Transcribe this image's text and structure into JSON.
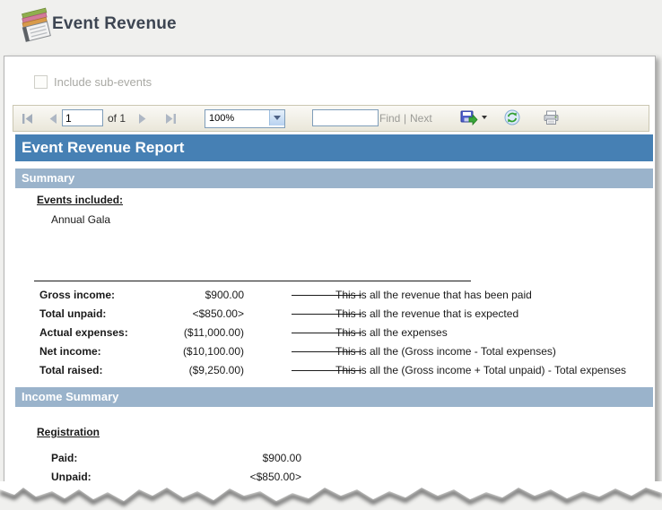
{
  "header": {
    "title": "Event Revenue"
  },
  "options": {
    "include_sub_events_label": "Include sub-events",
    "checked": false
  },
  "toolbar": {
    "page_value": "1",
    "of_label": "of 1",
    "zoom_value": "100%",
    "find_value": "",
    "find_label": "Find",
    "separator": "|",
    "next_label": "Next"
  },
  "report": {
    "title": "Event Revenue Report",
    "summary_section_label": "Summary",
    "events_included_label": "Events included:",
    "events": [
      "Annual Gala"
    ],
    "summary_rows": [
      {
        "label": "Gross income:",
        "value": "$900.00",
        "desc": "This is all the revenue that has been paid"
      },
      {
        "label": "Total unpaid:",
        "value": "<$850.00>",
        "desc": "This is all the revenue that is expected"
      },
      {
        "label": "Actual expenses:",
        "value": "($11,000.00)",
        "desc": "This is all the expenses"
      },
      {
        "label": "Net income:",
        "value": "($10,100.00)",
        "desc": "This is all the (Gross income - Total expenses)"
      },
      {
        "label": "Total raised:",
        "value": "($9,250.00)",
        "desc": "This is all the (Gross income + Total unpaid) - Total expenses"
      }
    ],
    "income_section_label": "Income Summary",
    "income_group_label": "Registration",
    "income_rows": [
      {
        "label": "Paid:",
        "value": "$900.00"
      },
      {
        "label": "Unpaid:",
        "value": "<$850.00>"
      }
    ]
  },
  "icons": {
    "app": "report-notebook-icon",
    "nav": [
      "first-page-icon",
      "previous-page-icon",
      "next-page-icon",
      "last-page-icon"
    ],
    "actions": [
      "export-icon",
      "refresh-icon",
      "print-icon"
    ]
  },
  "colors": {
    "report_title_bar": "#4680b4",
    "section_bar": "#9ab3cb",
    "toolbar_border": "#cbc7b2",
    "disabled_text": "#9b9b97"
  }
}
